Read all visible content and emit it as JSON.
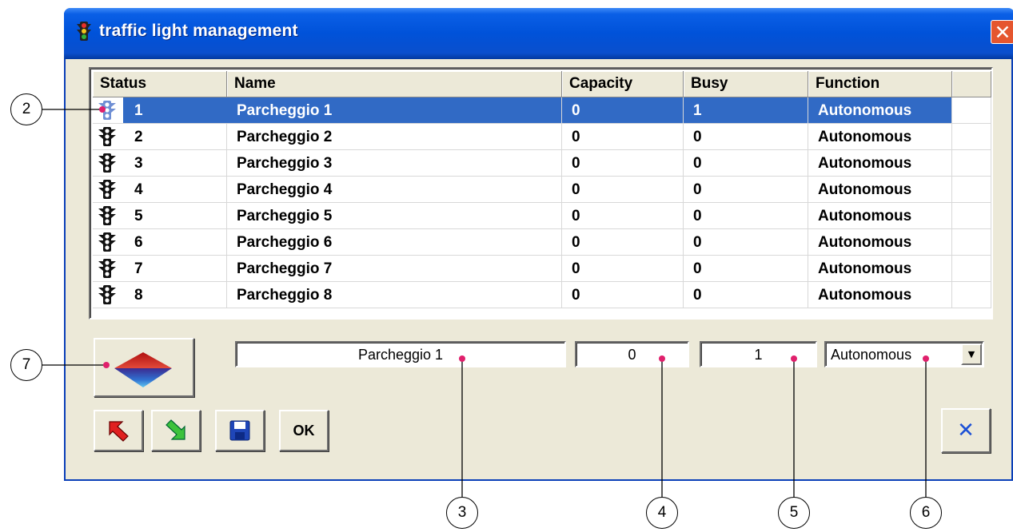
{
  "window": {
    "title": "traffic light management",
    "close_label": "✕"
  },
  "grid": {
    "headers": [
      "Status",
      "Name",
      "Capacity",
      "Busy",
      "Function"
    ],
    "rows": [
      {
        "status": "1",
        "name": "Parcheggio 1",
        "capacity": "0",
        "busy": "1",
        "function": "Autonomous",
        "selected": true
      },
      {
        "status": "2",
        "name": "Parcheggio 2",
        "capacity": "0",
        "busy": "0",
        "function": "Autonomous"
      },
      {
        "status": "3",
        "name": "Parcheggio 3",
        "capacity": "0",
        "busy": "0",
        "function": "Autonomous"
      },
      {
        "status": "4",
        "name": "Parcheggio 4",
        "capacity": "0",
        "busy": "0",
        "function": "Autonomous"
      },
      {
        "status": "5",
        "name": "Parcheggio 5",
        "capacity": "0",
        "busy": "0",
        "function": "Autonomous"
      },
      {
        "status": "6",
        "name": "Parcheggio 6",
        "capacity": "0",
        "busy": "0",
        "function": "Autonomous"
      },
      {
        "status": "7",
        "name": "Parcheggio 7",
        "capacity": "0",
        "busy": "0",
        "function": "Autonomous"
      },
      {
        "status": "8",
        "name": "Parcheggio 8",
        "capacity": "0",
        "busy": "0",
        "function": "Autonomous"
      }
    ]
  },
  "editor": {
    "name": "Parcheggio 1",
    "capacity": "0",
    "busy": "1",
    "function": "Autonomous"
  },
  "buttons": {
    "ok": "OK",
    "cancel": "✕"
  },
  "callouts": {
    "c2": "2",
    "c3": "3",
    "c4": "4",
    "c5": "5",
    "c6": "6",
    "c7": "7"
  },
  "colors": {
    "title_bar": "#0052d9",
    "selection": "#316ac5",
    "window_bg": "#ece9d8",
    "close": "#e5562f"
  },
  "icons": [
    "traffic-light-icon",
    "close-icon",
    "move-up-down-icon",
    "arrow-prev-icon",
    "arrow-next-icon",
    "save-icon",
    "cancel-icon",
    "dropdown-arrow-icon"
  ]
}
